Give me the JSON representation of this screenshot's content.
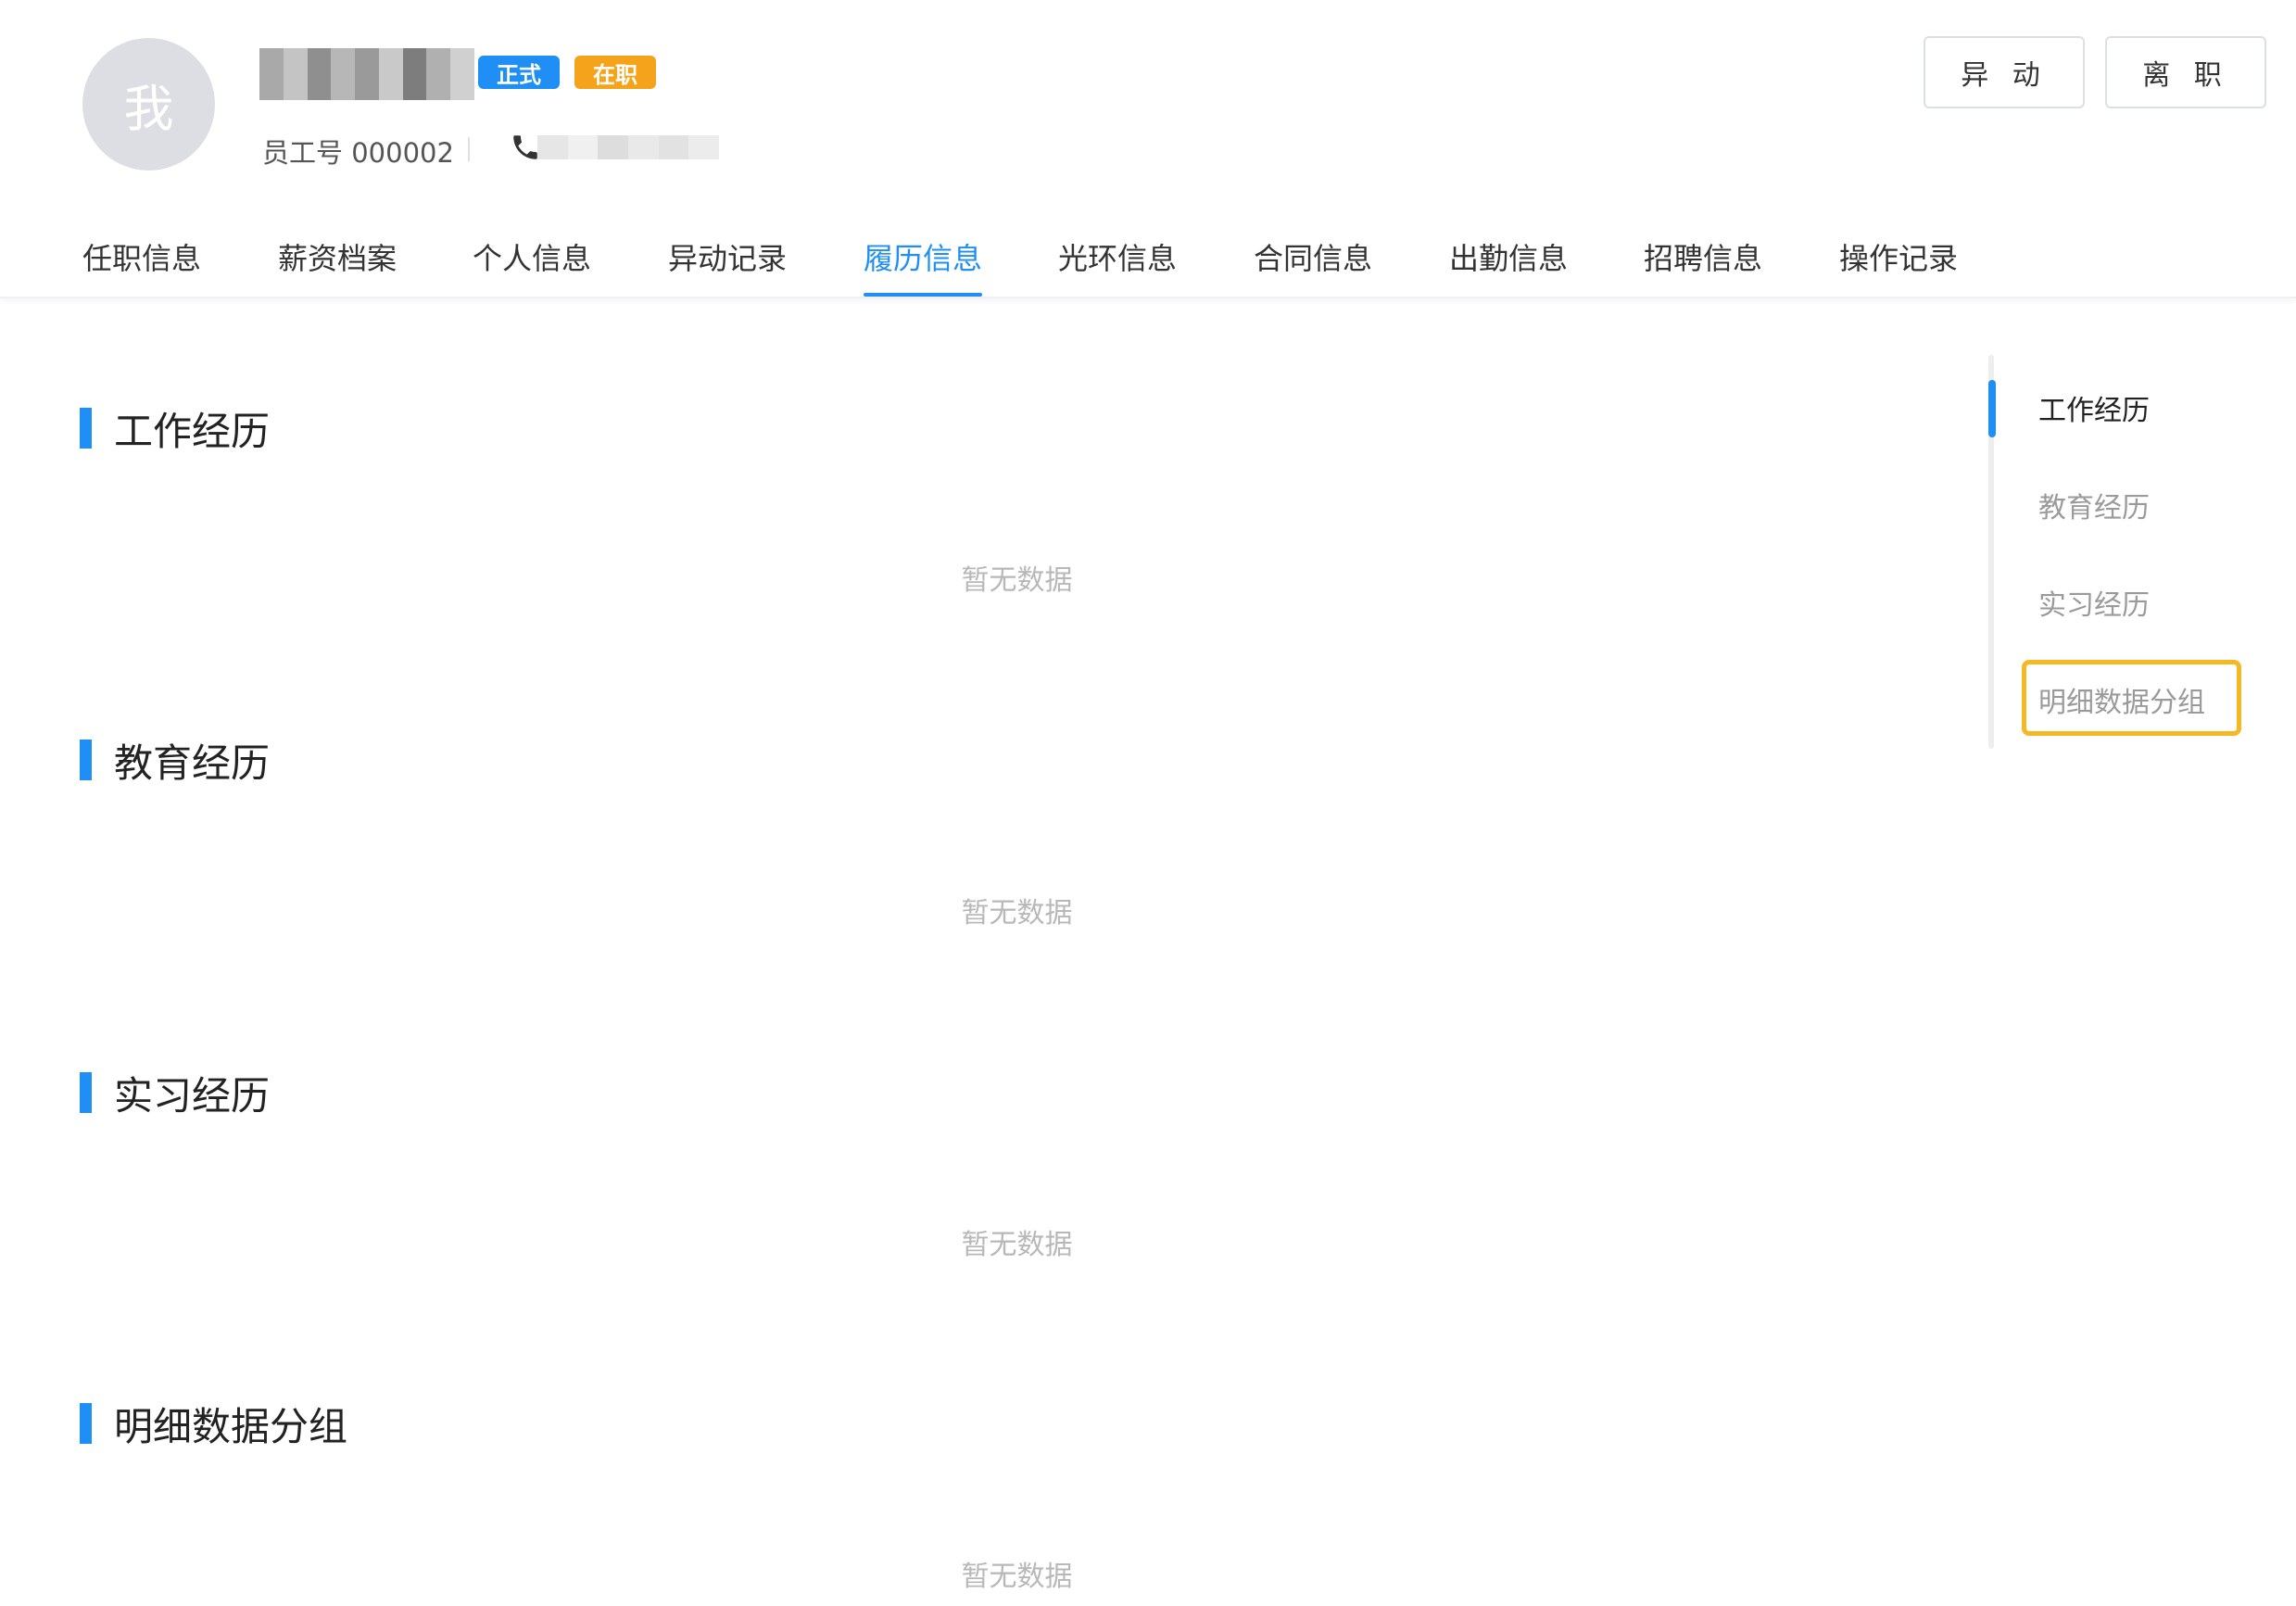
{
  "header": {
    "avatar_text": "我",
    "tags": {
      "formal": "正式",
      "active": "在职"
    },
    "employee_no": "员工号 000002",
    "actions": {
      "transfer": "异 动",
      "resign": "离 职"
    }
  },
  "tabs": [
    {
      "label": "任职信息"
    },
    {
      "label": "薪资档案"
    },
    {
      "label": "个人信息"
    },
    {
      "label": "异动记录"
    },
    {
      "label": "履历信息",
      "active": true
    },
    {
      "label": "光环信息"
    },
    {
      "label": "合同信息"
    },
    {
      "label": "出勤信息"
    },
    {
      "label": "招聘信息"
    },
    {
      "label": "操作记录"
    }
  ],
  "sections": [
    {
      "title": "工作经历",
      "empty_text": "暂无数据"
    },
    {
      "title": "教育经历",
      "empty_text": "暂无数据"
    },
    {
      "title": "实习经历",
      "empty_text": "暂无数据"
    },
    {
      "title": "明细数据分组",
      "empty_text": "暂无数据"
    }
  ],
  "anchor_nav": {
    "items": [
      {
        "label": "工作经历",
        "active": true
      },
      {
        "label": "教育经历"
      },
      {
        "label": "实习经历"
      },
      {
        "label": "明细数据分组",
        "highlighted": true
      }
    ]
  },
  "colors": {
    "primary": "#1f8ff5",
    "tag_active": "#f6a31c",
    "highlight": "#f5b822",
    "empty_text": "#b8b8b8"
  },
  "icons": {
    "phone": "phone-icon"
  }
}
